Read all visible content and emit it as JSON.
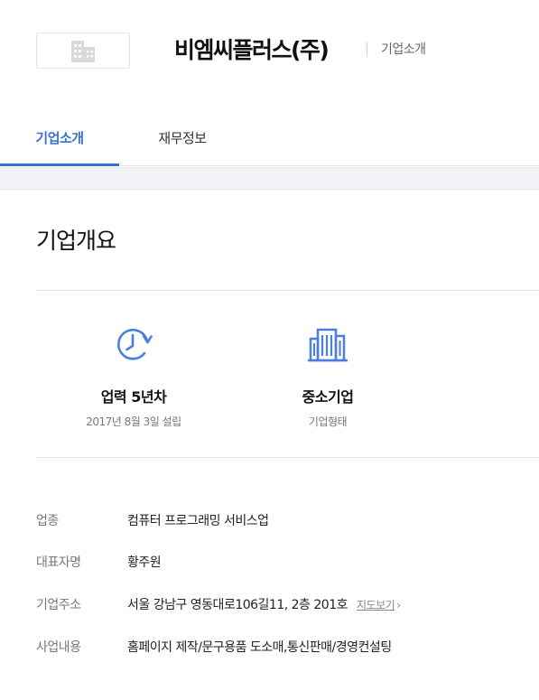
{
  "header": {
    "company_name": "비엠씨플러스(주)",
    "subtitle": "기업소개",
    "logo_icon": "building-placeholder-icon"
  },
  "tabs": [
    {
      "label": "기업소개",
      "active": true
    },
    {
      "label": "재무정보",
      "active": false
    }
  ],
  "overview": {
    "title": "기업개요",
    "stats": [
      {
        "icon": "clock-history-icon",
        "value": "업력 5년차",
        "label": "2017년 8월 3일 설립"
      },
      {
        "icon": "office-building-icon",
        "value": "중소기업",
        "label": "기업형태"
      }
    ],
    "details": [
      {
        "label": "업종",
        "value": "컴퓨터 프로그래밍 서비스업"
      },
      {
        "label": "대표자명",
        "value": "황주원"
      },
      {
        "label": "기업주소",
        "value": "서울 강남구 영동대로106길11, 2층 201호",
        "link": "지도보기"
      },
      {
        "label": "사업내용",
        "value": "홈페이지 제작/문구용품 도소매,통신판매/경영컨설팅"
      }
    ]
  },
  "colors": {
    "accent": "#3a6fd8",
    "icon_blue": "#4a7ee0",
    "band_gray": "#f2f3f6"
  }
}
